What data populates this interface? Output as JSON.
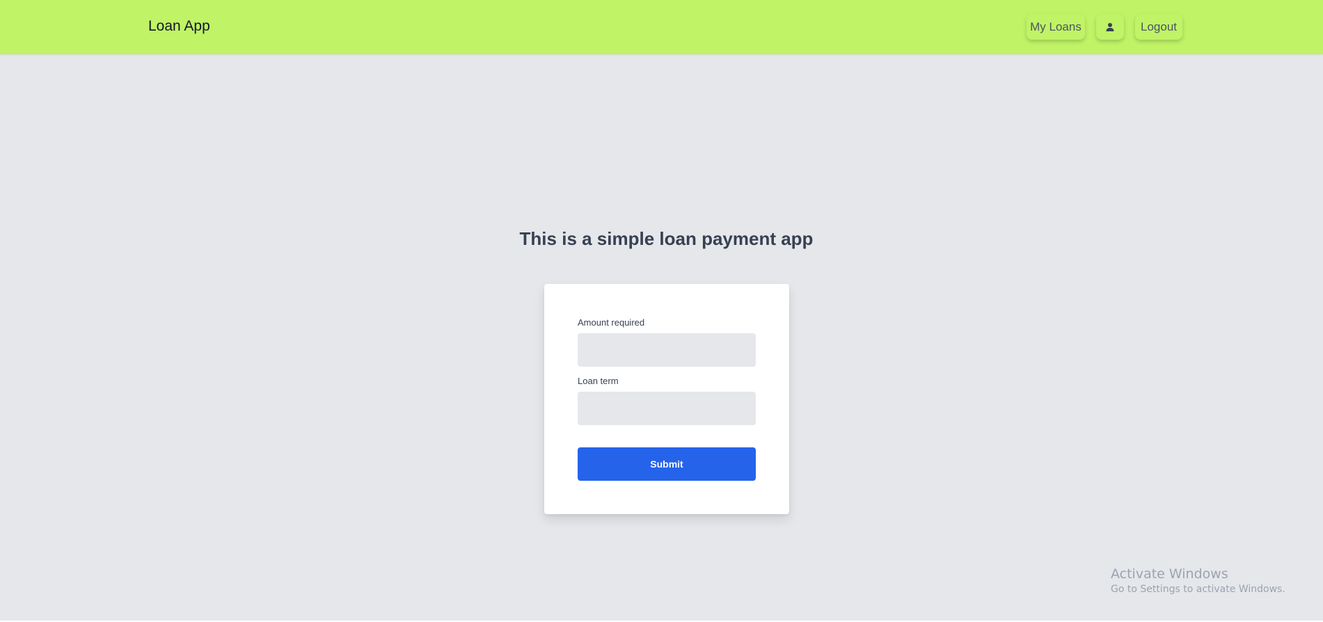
{
  "app": {
    "brand": "Loan App"
  },
  "nav": {
    "my_loans": "My Loans",
    "user_icon": "user-icon",
    "logout": "Logout"
  },
  "main": {
    "title": "This is a simple loan payment app"
  },
  "form": {
    "amount_label": "Amount required",
    "amount_value": "",
    "term_label": "Loan term",
    "term_value": "",
    "submit_label": "Submit"
  },
  "watermark": {
    "title": "Activate Windows",
    "subtitle": "Go to Settings to activate Windows."
  },
  "colors": {
    "navbar": "#c0f366",
    "background": "#e5e7eb",
    "primary": "#2563eb"
  }
}
